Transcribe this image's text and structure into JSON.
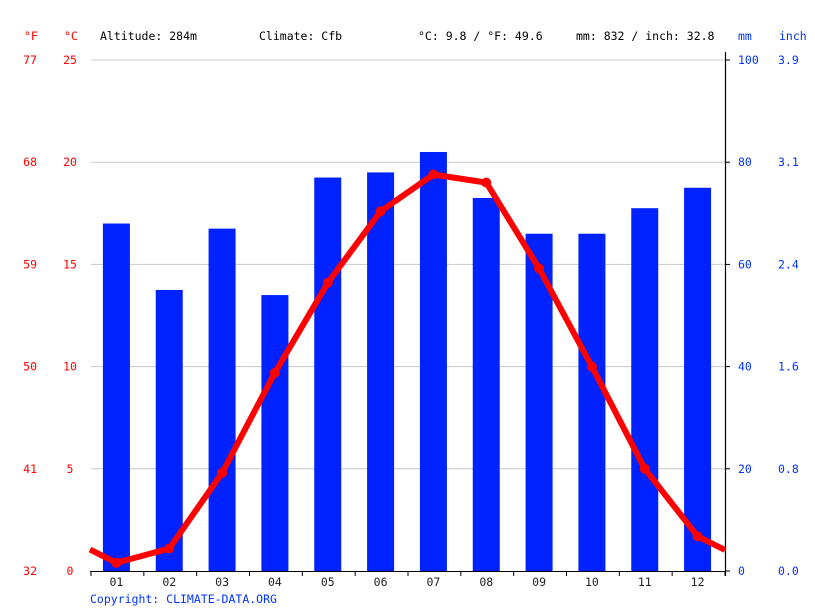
{
  "header": {
    "unit_f": "°F",
    "unit_c": "°C",
    "altitude": "Altitude: 284m",
    "climate": "Climate: Cfb",
    "temp_avg": "°C: 9.8 / °F: 49.6",
    "precip_total": "mm: 832 / inch: 32.8",
    "unit_mm": "mm",
    "unit_inch": "inch"
  },
  "copyright": "Copyright: CLIMATE-DATA.ORG",
  "colors": {
    "temperature": "#ff0000",
    "precipitation": "#0022ff",
    "grid": "#c8c8c8",
    "axis": "#000000",
    "left_labels": "#ff0000",
    "right_labels": "#0033ff"
  },
  "chart_data": {
    "type": "bar+line",
    "title": "",
    "categories": [
      "01",
      "02",
      "03",
      "04",
      "05",
      "06",
      "07",
      "08",
      "09",
      "10",
      "11",
      "12"
    ],
    "series": [
      {
        "name": "Precipitation (mm)",
        "type": "bar",
        "axis": "right",
        "values": [
          68,
          55,
          67,
          54,
          77,
          78,
          82,
          73,
          66,
          66,
          71,
          75
        ]
      },
      {
        "name": "Temperature (°C)",
        "type": "line",
        "axis": "left",
        "values": [
          0.4,
          1.1,
          4.8,
          9.7,
          14.1,
          17.6,
          19.4,
          19.0,
          14.8,
          10.0,
          5.0,
          1.7
        ]
      }
    ],
    "left_axis_c": {
      "label": "°C",
      "range": [
        0,
        25
      ],
      "ticks": [
        "0",
        "5",
        "10",
        "15",
        "20",
        "25"
      ]
    },
    "left_axis_f": {
      "label": "°F",
      "ticks": [
        "32",
        "41",
        "50",
        "59",
        "68",
        "77"
      ]
    },
    "right_axis_mm": {
      "label": "mm",
      "range": [
        0,
        100
      ],
      "ticks": [
        "0",
        "20",
        "40",
        "60",
        "80",
        "100"
      ]
    },
    "right_axis_inch": {
      "label": "inch",
      "ticks": [
        "0.0",
        "0.8",
        "1.6",
        "2.4",
        "3.1",
        "3.9"
      ]
    },
    "grid": true,
    "legend": "none"
  }
}
